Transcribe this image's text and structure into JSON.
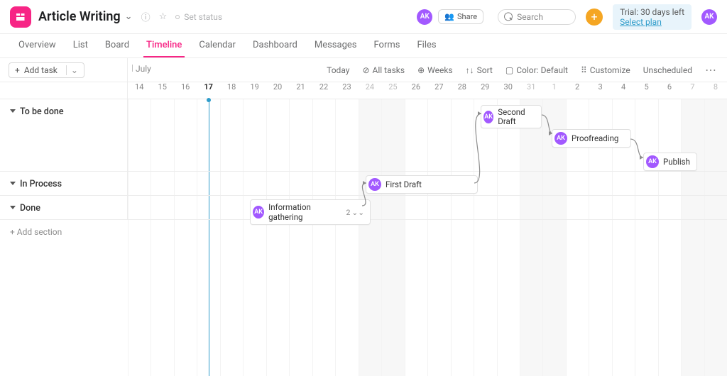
{
  "project": {
    "title": "Article Writing",
    "set_status": "Set status"
  },
  "user": {
    "initials": "AK"
  },
  "share_label": "Share",
  "search_placeholder": "Search",
  "trial": {
    "line1": "Trial: 30 days left",
    "line2": "Select plan"
  },
  "tabs": {
    "overview": "Overview",
    "list": "List",
    "board": "Board",
    "timeline": "Timeline",
    "calendar": "Calendar",
    "dashboard": "Dashboard",
    "messages": "Messages",
    "forms": "Forms",
    "files": "Files",
    "active": "timeline"
  },
  "toolbar": {
    "add_task": "Add task",
    "month": "July",
    "today": "Today",
    "all_tasks": "All tasks",
    "weeks": "Weeks",
    "sort": "Sort",
    "color": "Color: Default",
    "customize": "Customize",
    "unscheduled": "Unscheduled"
  },
  "days": [
    "14",
    "15",
    "16",
    "17",
    "18",
    "19",
    "20",
    "21",
    "22",
    "23",
    "24",
    "25",
    "26",
    "27",
    "28",
    "29",
    "30",
    "31",
    "1",
    "2",
    "3",
    "4",
    "5",
    "6",
    "7",
    "8"
  ],
  "weekend_idx": [
    10,
    11,
    17,
    18,
    24,
    25
  ],
  "today_idx": 3,
  "sections": {
    "to_be_done": "To be done",
    "in_process": "In Process",
    "done": "Done",
    "add_section": "+ Add section"
  },
  "tasks": {
    "second_draft": {
      "label": "Second Draft"
    },
    "first_draft": {
      "label": "First Draft"
    },
    "proofreading": {
      "label": "Proofreading"
    },
    "publish": {
      "label": "Publish"
    },
    "info_gather": {
      "label": "Information gathering",
      "subtasks": "2"
    }
  },
  "chart_data": {
    "type": "gantt",
    "x_unit": "day",
    "x_labels": [
      "Jul 14",
      "Jul 15",
      "Jul 16",
      "Jul 17",
      "Jul 18",
      "Jul 19",
      "Jul 20",
      "Jul 21",
      "Jul 22",
      "Jul 23",
      "Jul 24",
      "Jul 25",
      "Jul 26",
      "Jul 27",
      "Jul 28",
      "Jul 29",
      "Jul 30",
      "Jul 31",
      "Aug 1",
      "Aug 2",
      "Aug 3",
      "Aug 4",
      "Aug 5",
      "Aug 6",
      "Aug 7",
      "Aug 8"
    ],
    "today": "Jul 17",
    "sections": [
      {
        "name": "To be done",
        "tasks": [
          {
            "name": "Second Draft",
            "start": "Jul 29",
            "end": "Jul 30",
            "assignee": "AK"
          },
          {
            "name": "Proofreading",
            "start": "Aug 1",
            "end": "Aug 3",
            "assignee": "AK"
          },
          {
            "name": "Publish",
            "start": "Aug 5",
            "end": "Aug 6",
            "assignee": "AK"
          }
        ]
      },
      {
        "name": "In Process",
        "tasks": [
          {
            "name": "First Draft",
            "start": "Jul 24",
            "end": "Jul 28",
            "assignee": "AK"
          }
        ]
      },
      {
        "name": "Done",
        "tasks": [
          {
            "name": "Information gathering",
            "start": "Jul 19",
            "end": "Jul 23",
            "assignee": "AK",
            "subtasks": 2
          }
        ]
      }
    ],
    "dependencies": [
      [
        "Information gathering",
        "First Draft"
      ],
      [
        "First Draft",
        "Second Draft"
      ],
      [
        "Second Draft",
        "Proofreading"
      ],
      [
        "Proofreading",
        "Publish"
      ]
    ]
  }
}
